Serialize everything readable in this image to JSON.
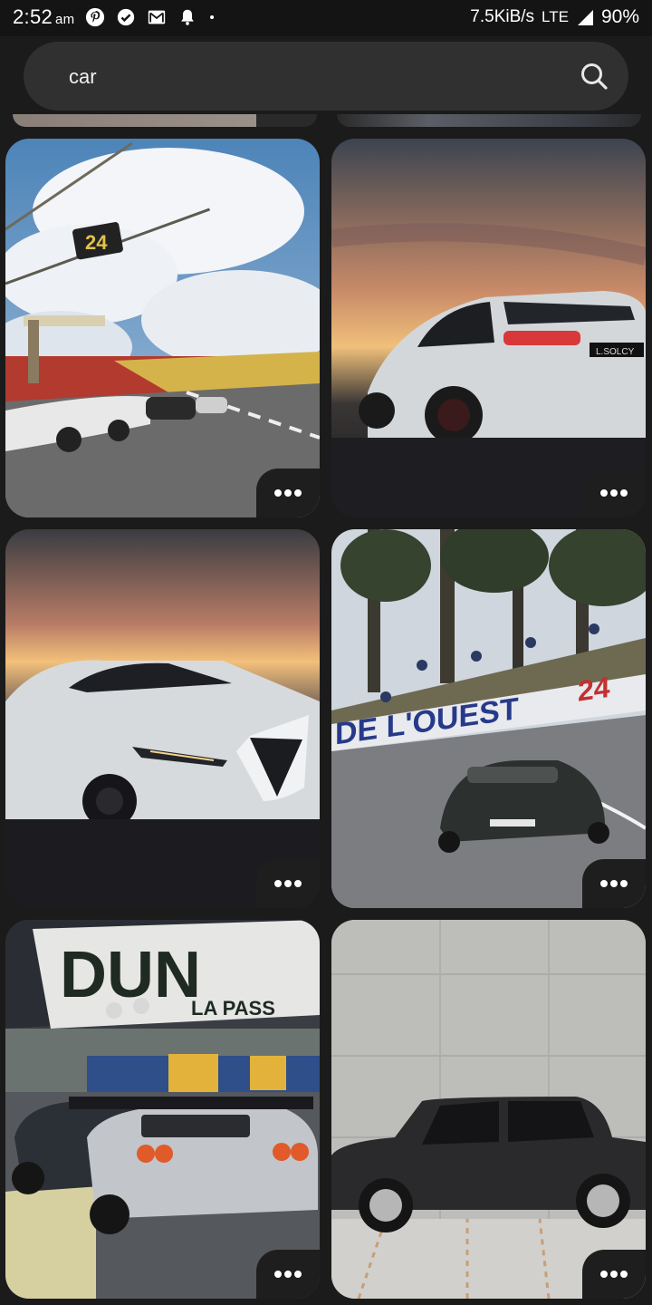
{
  "status_bar": {
    "time": "2:52",
    "ampm": "am",
    "icons": [
      "pinterest-icon",
      "check-circle-icon",
      "gmail-icon",
      "bell-icon",
      "dot-icon"
    ],
    "net_speed": "7.5KiB/s",
    "network": "LTE",
    "battery": "90%"
  },
  "search": {
    "query": "car",
    "icon": "search-icon"
  },
  "pins": [
    {
      "id": "pin-1",
      "description": "Race cars on track under cloudy sky",
      "more_icon": "more-horizontal-icon"
    },
    {
      "id": "pin-2",
      "description": "White sedan rear view at sunset",
      "more_icon": "more-horizontal-icon"
    },
    {
      "id": "pin-3",
      "description": "White sedan front view at sunset",
      "more_icon": "more-horizontal-icon"
    },
    {
      "id": "pin-4",
      "description": "Black race car on circuit with spectators",
      "more_icon": "more-horizontal-icon"
    },
    {
      "id": "pin-5",
      "description": "Race cars under sponsor banner",
      "more_icon": "more-horizontal-icon"
    },
    {
      "id": "pin-6",
      "description": "Black sedan against concrete wall",
      "more_icon": "more-horizontal-icon"
    }
  ],
  "image_text": {
    "track_sign": "24",
    "banner_left": "DE L'OUEST",
    "banner_right": "24",
    "dunlop": "DUN",
    "dunlop_sub": "LA PASS",
    "plate": "L.SOLCY"
  }
}
